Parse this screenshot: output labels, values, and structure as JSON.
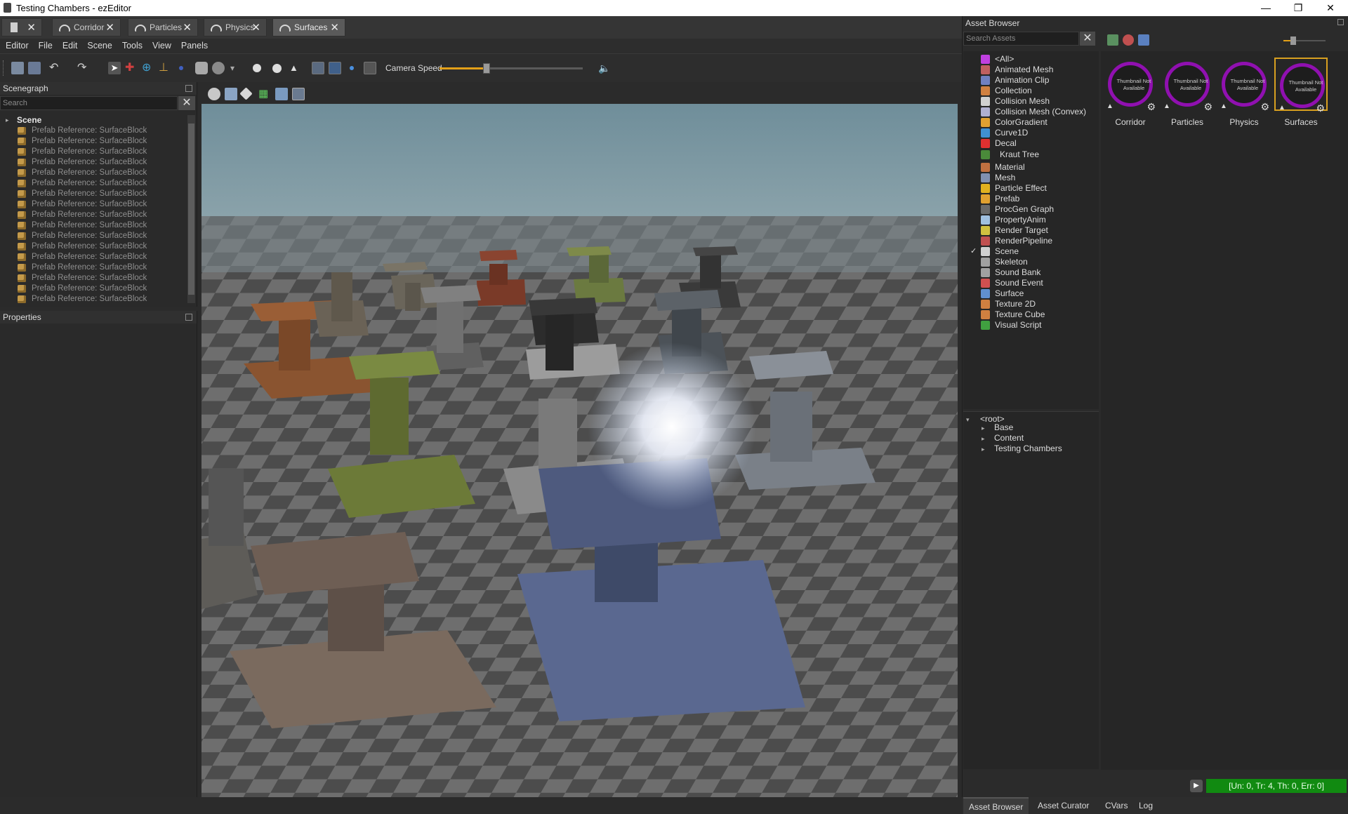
{
  "window": {
    "title": "Testing Chambers - ezEditor"
  },
  "tabs": [
    {
      "label": ""
    },
    {
      "label": "Corridor"
    },
    {
      "label": "Particles"
    },
    {
      "label": "Physics"
    },
    {
      "label": "Surfaces"
    }
  ],
  "menu": [
    "Editor",
    "File",
    "Edit",
    "Scene",
    "Tools",
    "View",
    "Panels"
  ],
  "toolbar": {
    "camera_speed_label": "Camera Speed",
    "camera_speed_value": 0.33
  },
  "scenegraph": {
    "title": "Scenegraph",
    "search_placeholder": "Search",
    "root": "Scene",
    "items": [
      "Prefab Reference: SurfaceBlock",
      "Prefab Reference: SurfaceBlock",
      "Prefab Reference: SurfaceBlock",
      "Prefab Reference: SurfaceBlock",
      "Prefab Reference: SurfaceBlock",
      "Prefab Reference: SurfaceBlock",
      "Prefab Reference: SurfaceBlock",
      "Prefab Reference: SurfaceBlock",
      "Prefab Reference: SurfaceBlock",
      "Prefab Reference: SurfaceBlock",
      "Prefab Reference: SurfaceBlock",
      "Prefab Reference: SurfaceBlock",
      "Prefab Reference: SurfaceBlock",
      "Prefab Reference: SurfaceBlock",
      "Prefab Reference: SurfaceBlock",
      "Prefab Reference: SurfaceBlock",
      "Prefab Reference: SurfaceBlock"
    ]
  },
  "properties": {
    "title": "Properties"
  },
  "asset_browser": {
    "title": "Asset Browser",
    "search_placeholder": "Search Assets",
    "types": [
      {
        "label": "<All>",
        "color": "#c040e0",
        "checked": false
      },
      {
        "label": "Animated Mesh",
        "color": "#c06060",
        "checked": false
      },
      {
        "label": "Animation Clip",
        "color": "#7080c0",
        "checked": false
      },
      {
        "label": "Collection",
        "color": "#d08040",
        "checked": false
      },
      {
        "label": "Collision Mesh",
        "color": "#d0d0d0",
        "checked": false
      },
      {
        "label": "Collision Mesh (Convex)",
        "color": "#b0b0d0",
        "checked": false
      },
      {
        "label": "ColorGradient",
        "color": "#e0a030",
        "checked": false
      },
      {
        "label": "Curve1D",
        "color": "#4090d0",
        "checked": false
      },
      {
        "label": "Decal",
        "color": "#e03030",
        "checked": false
      },
      {
        "label": "Kraut Tree",
        "color": "#4a8a3a",
        "checked": false
      },
      {
        "label": "Material",
        "color": "#c07040",
        "checked": false
      },
      {
        "label": "Mesh",
        "color": "#8090b0",
        "checked": false
      },
      {
        "label": "Particle Effect",
        "color": "#e0b020",
        "checked": false
      },
      {
        "label": "Prefab",
        "color": "#e0a030",
        "checked": false
      },
      {
        "label": "ProcGen Graph",
        "color": "#6a6a6a",
        "checked": false
      },
      {
        "label": "PropertyAnim",
        "color": "#a0c0e0",
        "checked": false
      },
      {
        "label": "Render Target",
        "color": "#d0c040",
        "checked": false
      },
      {
        "label": "RenderPipeline",
        "color": "#c05050",
        "checked": false
      },
      {
        "label": "Scene",
        "color": "#d0d0d0",
        "checked": true
      },
      {
        "label": "Skeleton",
        "color": "#a0a0a0",
        "checked": false
      },
      {
        "label": "Sound Bank",
        "color": "#a0a0a0",
        "checked": false
      },
      {
        "label": "Sound Event",
        "color": "#d05050",
        "checked": false
      },
      {
        "label": "Surface",
        "color": "#6090d0",
        "checked": false
      },
      {
        "label": "Texture 2D",
        "color": "#d08040",
        "checked": false
      },
      {
        "label": "Texture Cube",
        "color": "#d08040",
        "checked": false
      },
      {
        "label": "Visual Script",
        "color": "#40a040",
        "checked": false
      }
    ],
    "folders": [
      "<root>",
      "Base",
      "Content",
      "Testing Chambers"
    ],
    "assets": [
      {
        "name": "Corridor",
        "thumb": "Thumbnail Not Available",
        "selected": false
      },
      {
        "name": "Particles",
        "thumb": "Thumbnail Not Available",
        "selected": false
      },
      {
        "name": "Physics",
        "thumb": "Thumbnail Not Available",
        "selected": false
      },
      {
        "name": "Surfaces",
        "thumb": "Thumbnail Not Available",
        "selected": true
      }
    ]
  },
  "status": {
    "text": "[Un: 0, Tr: 4, Th: 0, Err: 0]"
  },
  "bottom_tabs": [
    "Asset Browser",
    "Asset Curator",
    "CVars",
    "Log"
  ]
}
